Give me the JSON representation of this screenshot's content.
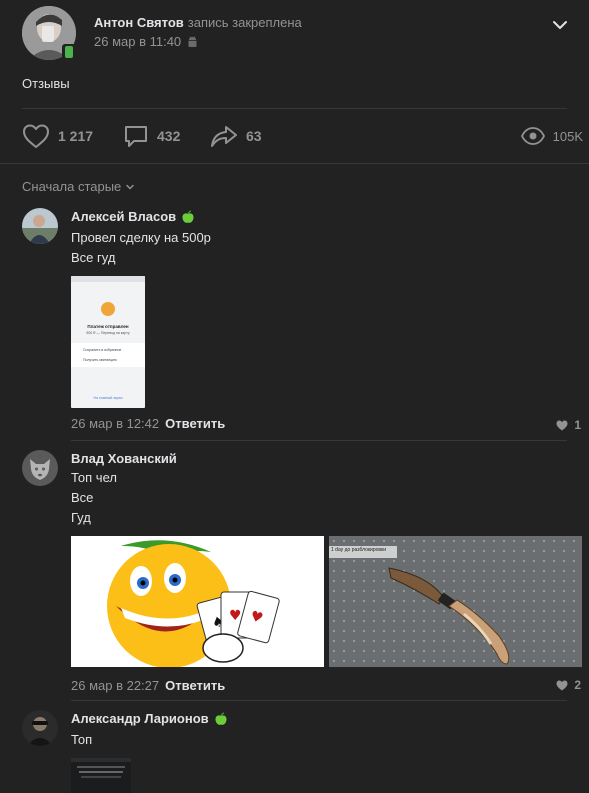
{
  "post": {
    "author": "Антон Святов",
    "pinned": "запись закреплена",
    "date": "26 мар в 11:40",
    "text": "Отзывы",
    "likes": "1 217",
    "comments": "432",
    "shares": "63",
    "views": "105K"
  },
  "sort_label": "Сначала старые",
  "comments": [
    {
      "name": "Алексей Власов",
      "lines": [
        "Провел сделку на 500р",
        "Все гуд"
      ],
      "screenshot": {
        "status": "Платеж отправлен",
        "amount": "500 ₽ — Перевод на карту",
        "save": "Сохранить в избранное",
        "receipt": "Получить квитанцию",
        "link": "На главный экран"
      },
      "date": "26 мар в 12:42",
      "reply": "Ответить",
      "likes": "1"
    },
    {
      "name": "Влад Хованский",
      "lines": [
        "Топ чел",
        "Все",
        "Гуд"
      ],
      "image_caption": "1 day до разблокировки",
      "date": "26 мар в 22:27",
      "reply": "Ответить",
      "likes": "2"
    },
    {
      "name": "Александр Ларионов",
      "lines": [
        "Топ"
      ]
    }
  ],
  "colors": {
    "background": "#222222",
    "text": "#e1e3e6",
    "secondary": "#939393",
    "divider": "#363738",
    "online": "#4bb34b"
  },
  "icons": [
    "chevron-down-icon",
    "android-icon",
    "heart-icon",
    "comment-icon",
    "share-icon",
    "eye-icon",
    "apple-icon"
  ]
}
